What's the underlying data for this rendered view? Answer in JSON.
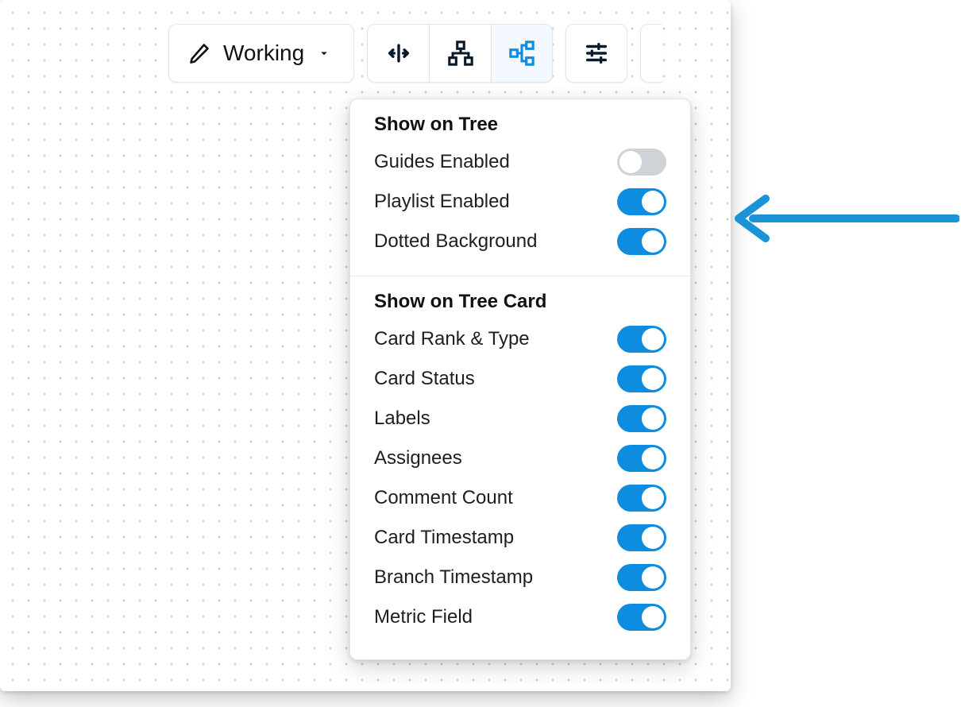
{
  "mode": {
    "label": "Working"
  },
  "colors": {
    "accent": "#0d8ce0"
  },
  "icons": {
    "pencil": "pencil-icon",
    "compress": "compress-horizontal-icon",
    "tree_up": "tree-up-icon",
    "tree_side": "tree-side-icon",
    "sliders": "sliders-icon"
  },
  "panel": {
    "tree": {
      "title": "Show on Tree",
      "items": [
        {
          "label": "Guides Enabled",
          "on": false
        },
        {
          "label": "Playlist Enabled",
          "on": true
        },
        {
          "label": "Dotted Background",
          "on": true
        }
      ]
    },
    "card": {
      "title": "Show on Tree Card",
      "items": [
        {
          "label": "Card Rank & Type",
          "on": true
        },
        {
          "label": "Card Status",
          "on": true
        },
        {
          "label": "Labels",
          "on": true
        },
        {
          "label": "Assignees",
          "on": true
        },
        {
          "label": "Comment Count",
          "on": true
        },
        {
          "label": "Card Timestamp",
          "on": true
        },
        {
          "label": "Branch Timestamp",
          "on": true
        },
        {
          "label": "Metric Field",
          "on": true
        }
      ]
    }
  }
}
